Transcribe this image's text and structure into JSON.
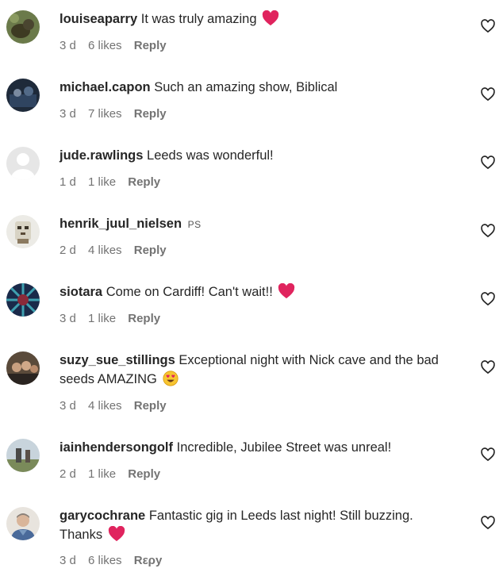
{
  "colors": {
    "text": "#262626",
    "meta": "#737373",
    "heart": "#e0245e"
  },
  "comments": [
    {
      "username": "louiseaparry",
      "text": "It was truly amazing",
      "emoji": "heart",
      "time": "3 d",
      "likes": "6 likes",
      "reply": "Reply"
    },
    {
      "username": "michael.capon",
      "text": "Such an amazing show, Biblical",
      "time": "3 d",
      "likes": "7 likes",
      "reply": "Reply"
    },
    {
      "username": "jude.rawlings",
      "text": "Leeds was wonderful!",
      "time": "1 d",
      "likes": "1 like",
      "reply": "Reply"
    },
    {
      "username": "henrik_juul_nielsen",
      "text": "PS",
      "time": "2 d",
      "likes": "4 likes",
      "reply": "Reply"
    },
    {
      "username": "siotara",
      "text": "Come on Cardiff! Can't wait!!",
      "emoji": "heart",
      "time": "3 d",
      "likes": "1 like",
      "reply": "Reply"
    },
    {
      "username": "suzy_sue_stillings",
      "text": "Exceptional night with Nick cave and the bad seeds AMAZING",
      "emoji": "heart-eyes",
      "time": "3 d",
      "likes": "4 likes",
      "reply": "Reply"
    },
    {
      "username": "iainhendersongolf",
      "text": "Incredible, Jubilee Street was unreal!",
      "time": "2 d",
      "likes": "1 like",
      "reply": "Reply"
    },
    {
      "username": "garycochrane",
      "text": "Fantastic gig in Leeds last night! Still buzzing. Thanks",
      "emoji": "heart",
      "time": "3 d",
      "likes": "6 likes",
      "reply": "Rερy"
    }
  ]
}
